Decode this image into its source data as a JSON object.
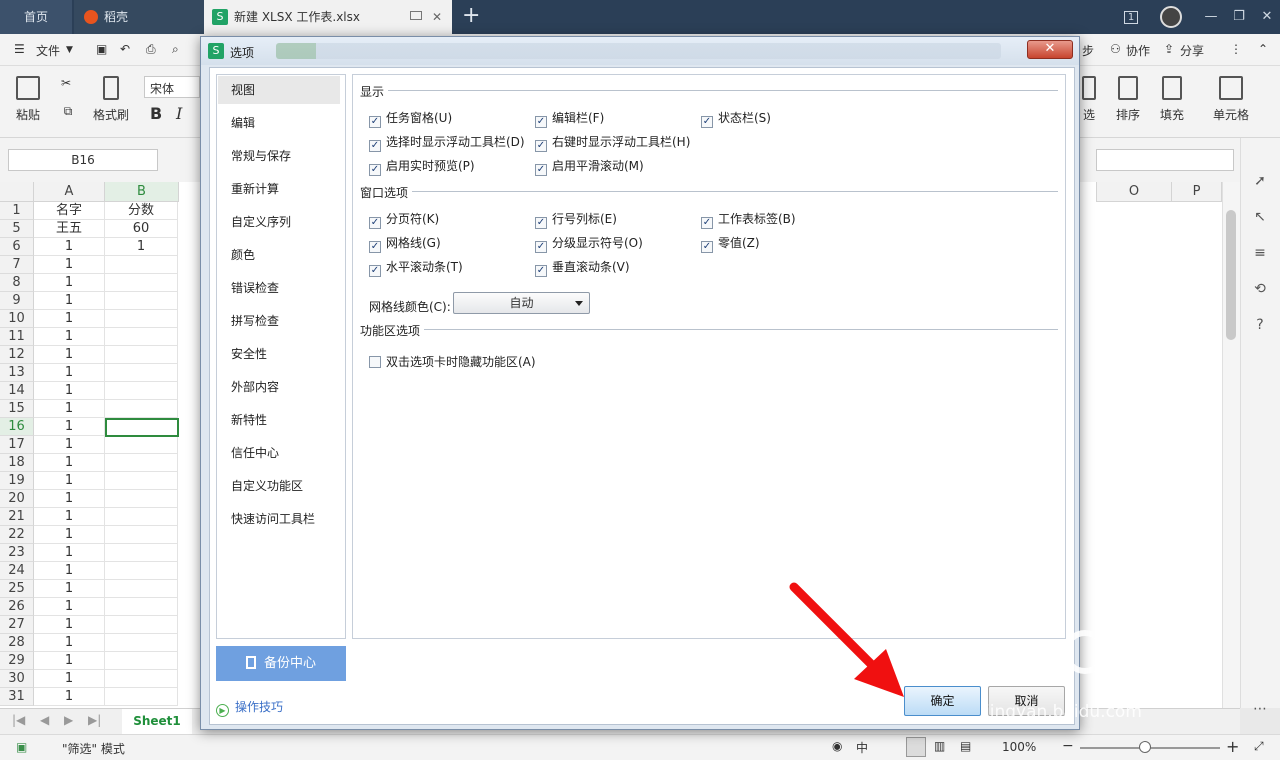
{
  "tabs": {
    "home": "首页",
    "daoke": "稻壳",
    "file": "新建 XLSX 工作表.xlsx",
    "add": "+"
  },
  "window": {
    "badge": "1",
    "minimize": "—",
    "restore": "❐",
    "close": "✕"
  },
  "menu": {
    "file": "文件",
    "sync": "步",
    "collab": "协作",
    "share": "分享",
    "more": "⋮",
    "collapse": "⌃"
  },
  "ribbon": {
    "paste": "粘贴",
    "format_painter": "格式刷",
    "font": "宋体",
    "bold": "B",
    "italic": "I",
    "filter": "选",
    "sort": "排序",
    "fill": "填充",
    "cell": "单元格"
  },
  "formula": {
    "namebox": "B16"
  },
  "grid": {
    "columns": [
      "A",
      "B",
      "O",
      "P"
    ],
    "rows": [
      {
        "n": "1",
        "a": "名字",
        "b": "分数"
      },
      {
        "n": "5",
        "a": "王五",
        "b": "60"
      },
      {
        "n": "6",
        "a": "1",
        "b": "1"
      },
      {
        "n": "7",
        "a": "1",
        "b": ""
      },
      {
        "n": "8",
        "a": "1",
        "b": ""
      },
      {
        "n": "9",
        "a": "1",
        "b": ""
      },
      {
        "n": "10",
        "a": "1",
        "b": ""
      },
      {
        "n": "11",
        "a": "1",
        "b": ""
      },
      {
        "n": "12",
        "a": "1",
        "b": ""
      },
      {
        "n": "13",
        "a": "1",
        "b": ""
      },
      {
        "n": "14",
        "a": "1",
        "b": ""
      },
      {
        "n": "15",
        "a": "1",
        "b": ""
      },
      {
        "n": "16",
        "a": "1",
        "b": ""
      },
      {
        "n": "17",
        "a": "1",
        "b": ""
      },
      {
        "n": "18",
        "a": "1",
        "b": ""
      },
      {
        "n": "19",
        "a": "1",
        "b": ""
      },
      {
        "n": "20",
        "a": "1",
        "b": ""
      },
      {
        "n": "21",
        "a": "1",
        "b": ""
      },
      {
        "n": "22",
        "a": "1",
        "b": ""
      },
      {
        "n": "23",
        "a": "1",
        "b": ""
      },
      {
        "n": "24",
        "a": "1",
        "b": ""
      },
      {
        "n": "25",
        "a": "1",
        "b": ""
      },
      {
        "n": "26",
        "a": "1",
        "b": ""
      },
      {
        "n": "27",
        "a": "1",
        "b": ""
      },
      {
        "n": "28",
        "a": "1",
        "b": ""
      },
      {
        "n": "29",
        "a": "1",
        "b": ""
      },
      {
        "n": "30",
        "a": "1",
        "b": ""
      },
      {
        "n": "31",
        "a": "1",
        "b": ""
      }
    ]
  },
  "sheet": {
    "tab": "Sheet1"
  },
  "status": {
    "mode": "\"筛选\" 模式",
    "zoom": "100%",
    "minus": "−",
    "plus": "+"
  },
  "dialog": {
    "title": "选项",
    "close": "✕",
    "nav": [
      "视图",
      "编辑",
      "常规与保存",
      "重新计算",
      "自定义序列",
      "颜色",
      "错误检查",
      "拼写检查",
      "安全性",
      "外部内容",
      "新特性",
      "信任中心",
      "自定义功能区",
      "快速访问工具栏"
    ],
    "selected_nav": "视图",
    "backup": "备份中心",
    "tips": "操作技巧",
    "sections": {
      "display": "显示",
      "window_options": "窗口选项",
      "ribbon_options": "功能区选项"
    },
    "display_options": [
      {
        "label": "任务窗格(U)",
        "checked": true
      },
      {
        "label": "编辑栏(F)",
        "checked": true
      },
      {
        "label": "状态栏(S)",
        "checked": true
      },
      {
        "label": "选择时显示浮动工具栏(D)",
        "checked": true
      },
      {
        "label": "右键时显示浮动工具栏(H)",
        "checked": true
      },
      {
        "label": "启用实时预览(P)",
        "checked": true
      },
      {
        "label": "启用平滑滚动(M)",
        "checked": true
      }
    ],
    "window_opts": [
      {
        "label": "分页符(K)",
        "checked": true
      },
      {
        "label": "行号列标(E)",
        "checked": true
      },
      {
        "label": "工作表标签(B)",
        "checked": true
      },
      {
        "label": "网格线(G)",
        "checked": true
      },
      {
        "label": "分级显示符号(O)",
        "checked": true
      },
      {
        "label": "零值(Z)",
        "checked": true
      },
      {
        "label": "水平滚动条(T)",
        "checked": true
      },
      {
        "label": "垂直滚动条(V)",
        "checked": true
      }
    ],
    "gridline_color_label": "网格线颜色(C):",
    "gridline_color_value": "自动",
    "ribbon_opts": [
      {
        "label": "双击选项卡时隐藏功能区(A)",
        "checked": false
      }
    ],
    "ok": "确定",
    "cancel": "取消"
  },
  "watermark": {
    "brand": "Bai",
    "brand2": "经验",
    "url": "jingyan.baidu.com"
  }
}
